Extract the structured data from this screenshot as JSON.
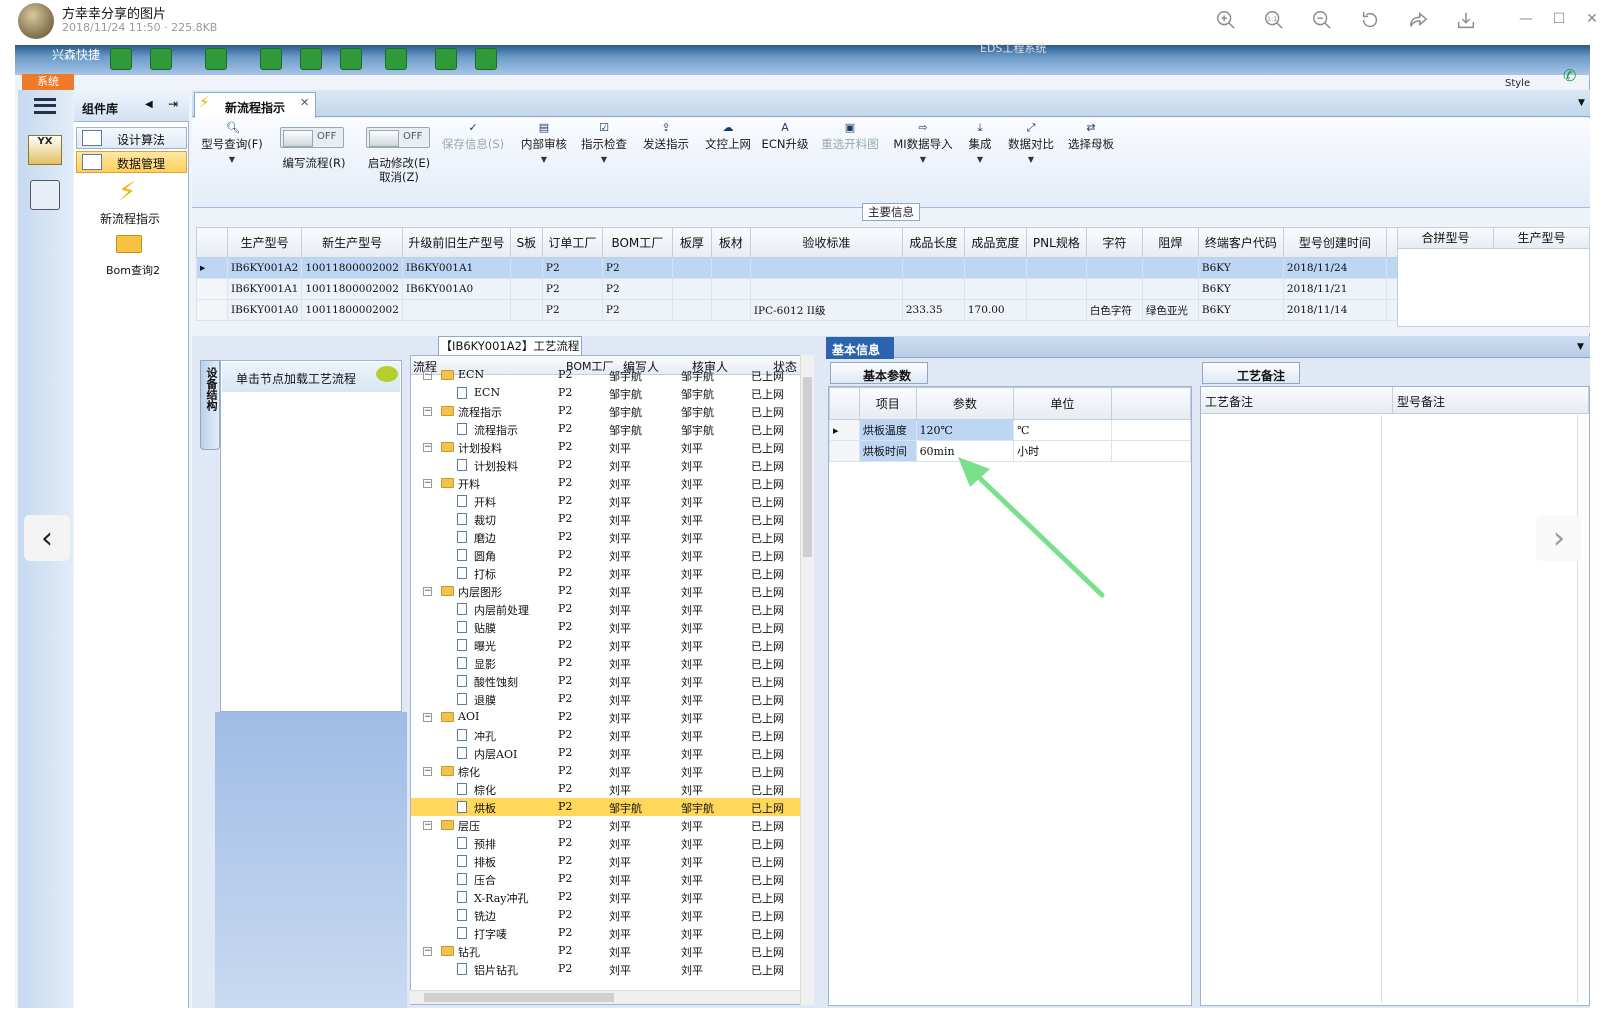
{
  "viewer": {
    "title": "方幸幸分享的图片",
    "meta": "2018/11/24 11:50 · 225.8KB",
    "toolbar_icons": [
      "zoom-in-icon",
      "actual-size-icon",
      "zoom-out-icon",
      "rotate-icon",
      "share-icon",
      "download-icon"
    ],
    "actual_size_label": "1:1"
  },
  "app": {
    "name": "兴森快捷",
    "window_title": "EDS工程系统",
    "sys_button": "系统",
    "style_label": "Style"
  },
  "component_lib": {
    "title": "组件库",
    "items": [
      {
        "label": "设计算法"
      },
      {
        "label": "数据管理"
      }
    ],
    "tools": [
      {
        "label": "新流程指示"
      },
      {
        "label": "Bom查询2"
      }
    ]
  },
  "tab": {
    "label": "新流程指示"
  },
  "ribbon": {
    "buttons": [
      {
        "label": "型号查询(F)"
      },
      {
        "label": "编写流程(R)"
      },
      {
        "label": "启动修改(E)",
        "sub": "取消(Z)"
      },
      {
        "label": "保存信息(S)"
      },
      {
        "label": "内部审核"
      },
      {
        "label": "指示检查"
      },
      {
        "label": "发送指示"
      },
      {
        "label": "文控上网"
      },
      {
        "label": "ECN升级"
      },
      {
        "label": "重选开料图"
      },
      {
        "label": "MI数据导入"
      },
      {
        "label": "集成"
      },
      {
        "label": "数据对比"
      },
      {
        "label": "选择母板"
      }
    ],
    "toggle_off": "OFF"
  },
  "main_info": {
    "label": "主要信息",
    "columns": [
      "生产型号",
      "新生产型号",
      "升级前旧生产型号",
      "S板",
      "订单工厂",
      "BOM工厂",
      "板厚",
      "板材",
      "验收标准",
      "成品长度",
      "成品宽度",
      "PNL规格",
      "字符",
      "阻焊",
      "终端客户代码",
      "型号创建时间"
    ],
    "rows": [
      [
        "IB6KY001A2",
        "10011800002002",
        "IB6KY001A1",
        "",
        "P2",
        "P2",
        "",
        "",
        "",
        "",
        "",
        "",
        "",
        "",
        "B6KY",
        "2018/11/24"
      ],
      [
        "IB6KY001A1",
        "10011800002002",
        "IB6KY001A0",
        "",
        "P2",
        "P2",
        "",
        "",
        "",
        "",
        "",
        "",
        "",
        "",
        "B6KY",
        "2018/11/21"
      ],
      [
        "IB6KY001A0",
        "10011800002002",
        "",
        "",
        "P2",
        "P2",
        "",
        "",
        "IPC-6012 II级",
        "233.35",
        "170.00",
        "",
        "白色字符",
        "绿色亚光",
        "B6KY",
        "2018/11/14"
      ]
    ],
    "merge_columns": [
      "合拼型号",
      "生产型号"
    ]
  },
  "process": {
    "title": "【IB6KY001A2】工艺流程",
    "side_tab": "设备结构",
    "node_hint": "单击节点加载工艺流程",
    "columns": [
      "流程",
      "BOM工厂",
      "编写人",
      "核审人",
      "状态"
    ],
    "rows": [
      {
        "name": "ECN",
        "level": 0,
        "bom": "P2",
        "writer": "邹宇航",
        "reviewer": "邹宇航",
        "status": "已上网"
      },
      {
        "name": "ECN",
        "level": 1,
        "bom": "P2",
        "writer": "邹宇航",
        "reviewer": "邹宇航",
        "status": "已上网"
      },
      {
        "name": "流程指示",
        "level": 0,
        "bom": "P2",
        "writer": "邹宇航",
        "reviewer": "邹宇航",
        "status": "已上网"
      },
      {
        "name": "流程指示",
        "level": 1,
        "bom": "P2",
        "writer": "邹宇航",
        "reviewer": "邹宇航",
        "status": "已上网"
      },
      {
        "name": "计划投料",
        "level": 0,
        "bom": "P2",
        "writer": "刘平",
        "reviewer": "刘平",
        "status": "已上网"
      },
      {
        "name": "计划投料",
        "level": 1,
        "bom": "P2",
        "writer": "刘平",
        "reviewer": "刘平",
        "status": "已上网"
      },
      {
        "name": "开料",
        "level": 0,
        "bom": "P2",
        "writer": "刘平",
        "reviewer": "刘平",
        "status": "已上网"
      },
      {
        "name": "开料",
        "level": 1,
        "bom": "P2",
        "writer": "刘平",
        "reviewer": "刘平",
        "status": "已上网"
      },
      {
        "name": "裁切",
        "level": 1,
        "bom": "P2",
        "writer": "刘平",
        "reviewer": "刘平",
        "status": "已上网"
      },
      {
        "name": "磨边",
        "level": 1,
        "bom": "P2",
        "writer": "刘平",
        "reviewer": "刘平",
        "status": "已上网"
      },
      {
        "name": "圆角",
        "level": 1,
        "bom": "P2",
        "writer": "刘平",
        "reviewer": "刘平",
        "status": "已上网"
      },
      {
        "name": "打标",
        "level": 1,
        "bom": "P2",
        "writer": "刘平",
        "reviewer": "刘平",
        "status": "已上网"
      },
      {
        "name": "内层图形",
        "level": 0,
        "bom": "P2",
        "writer": "刘平",
        "reviewer": "刘平",
        "status": "已上网"
      },
      {
        "name": "内层前处理",
        "level": 1,
        "bom": "P2",
        "writer": "刘平",
        "reviewer": "刘平",
        "status": "已上网"
      },
      {
        "name": "贴膜",
        "level": 1,
        "bom": "P2",
        "writer": "刘平",
        "reviewer": "刘平",
        "status": "已上网"
      },
      {
        "name": "曝光",
        "level": 1,
        "bom": "P2",
        "writer": "刘平",
        "reviewer": "刘平",
        "status": "已上网"
      },
      {
        "name": "显影",
        "level": 1,
        "bom": "P2",
        "writer": "刘平",
        "reviewer": "刘平",
        "status": "已上网"
      },
      {
        "name": "酸性蚀刻",
        "level": 1,
        "bom": "P2",
        "writer": "刘平",
        "reviewer": "刘平",
        "status": "已上网"
      },
      {
        "name": "退膜",
        "level": 1,
        "bom": "P2",
        "writer": "刘平",
        "reviewer": "刘平",
        "status": "已上网"
      },
      {
        "name": "AOI",
        "level": 0,
        "bom": "P2",
        "writer": "刘平",
        "reviewer": "刘平",
        "status": "已上网"
      },
      {
        "name": "冲孔",
        "level": 1,
        "bom": "P2",
        "writer": "刘平",
        "reviewer": "刘平",
        "status": "已上网"
      },
      {
        "name": "内层AOI",
        "level": 1,
        "bom": "P2",
        "writer": "刘平",
        "reviewer": "刘平",
        "status": "已上网"
      },
      {
        "name": "棕化",
        "level": 0,
        "bom": "P2",
        "writer": "刘平",
        "reviewer": "刘平",
        "status": "已上网"
      },
      {
        "name": "棕化",
        "level": 1,
        "bom": "P2",
        "writer": "刘平",
        "reviewer": "刘平",
        "status": "已上网"
      },
      {
        "name": "烘板",
        "level": 1,
        "bom": "P2",
        "writer": "邹宇航",
        "reviewer": "邹宇航",
        "status": "已上网",
        "selected": true
      },
      {
        "name": "层压",
        "level": 0,
        "bom": "P2",
        "writer": "刘平",
        "reviewer": "刘平",
        "status": "已上网"
      },
      {
        "name": "预排",
        "level": 1,
        "bom": "P2",
        "writer": "刘平",
        "reviewer": "刘平",
        "status": "已上网"
      },
      {
        "name": "排板",
        "level": 1,
        "bom": "P2",
        "writer": "刘平",
        "reviewer": "刘平",
        "status": "已上网"
      },
      {
        "name": "压合",
        "level": 1,
        "bom": "P2",
        "writer": "刘平",
        "reviewer": "刘平",
        "status": "已上网"
      },
      {
        "name": "X-Ray冲孔",
        "level": 1,
        "bom": "P2",
        "writer": "刘平",
        "reviewer": "刘平",
        "status": "已上网"
      },
      {
        "name": "铣边",
        "level": 1,
        "bom": "P2",
        "writer": "刘平",
        "reviewer": "刘平",
        "status": "已上网"
      },
      {
        "name": "打字唛",
        "level": 1,
        "bom": "P2",
        "writer": "刘平",
        "reviewer": "刘平",
        "status": "已上网"
      },
      {
        "name": "钻孔",
        "level": 0,
        "bom": "P2",
        "writer": "刘平",
        "reviewer": "刘平",
        "status": "已上网"
      },
      {
        "name": "铝片钻孔",
        "level": 1,
        "bom": "P2",
        "writer": "刘平",
        "reviewer": "刘平",
        "status": "已上网"
      }
    ]
  },
  "basic_info": {
    "tab": "基本信息",
    "subtab_params": "基本参数",
    "subtab_remarks": "工艺备注",
    "param_columns": [
      "项目",
      "参数",
      "单位"
    ],
    "params": [
      [
        "烘板温度",
        "120℃",
        "℃"
      ],
      [
        "烘板时间",
        "60min",
        "小时"
      ]
    ],
    "remark_columns": [
      "工艺备注",
      "型号备注"
    ]
  },
  "colors": {
    "accent": "#2a64b0",
    "selection": "#bcd6f4",
    "tree_selection": "#ffd75a",
    "arrow": "#7be08a"
  }
}
